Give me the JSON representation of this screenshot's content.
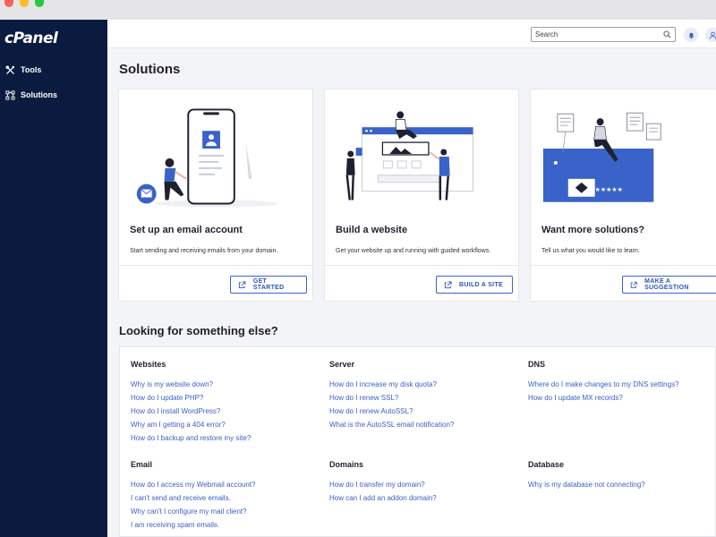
{
  "brand": {
    "logo": "cPanel"
  },
  "sidebar": {
    "items": [
      {
        "label": "Tools"
      },
      {
        "label": "Solutions"
      }
    ]
  },
  "topbar": {
    "search_placeholder": "Search"
  },
  "page": {
    "title": "Solutions"
  },
  "cards": [
    {
      "title": "Set up an email account",
      "description": "Start sending and receiving emails from your domain.",
      "button": "GET STARTED"
    },
    {
      "title": "Build a website",
      "description": "Get your website up and running with guided workflows.",
      "button": "BUILD A SITE"
    },
    {
      "title": "Want more solutions?",
      "description": "Tell us what you would like to learn.",
      "button": "MAKE A SUGGESTION"
    }
  ],
  "help": {
    "title": "Looking for something else?",
    "groups": [
      {
        "title": "Websites",
        "links": [
          "Why is my website down?",
          "How do I update PHP?",
          "How do I install WordPress?",
          "Why am I getting a 404 error?",
          "How do I backup and restore my site?"
        ]
      },
      {
        "title": "Server",
        "links": [
          "How do I increase my disk quota?",
          "How do I renew SSL?",
          "How do I renew AutoSSL?",
          "What is the AutoSSL email notification?"
        ]
      },
      {
        "title": "DNS",
        "links": [
          "Where do I make changes to my DNS settings?",
          "How do I update MX records?"
        ]
      },
      {
        "title": "Email",
        "links": [
          "How do I access my Webmail account?",
          "I can't send and receive emails.",
          "Why can't I configure my mail client?",
          "I am receiving spam emails."
        ]
      },
      {
        "title": "Domains",
        "links": [
          "How do I transfer my domain?",
          "How can I add an addon domain?"
        ]
      },
      {
        "title": "Database",
        "links": [
          "Why is my database not connecting?"
        ]
      }
    ]
  },
  "colors": {
    "sidebar_bg": "#0b1b3f",
    "accent": "#3a63c9",
    "link": "#3d5fc4",
    "dot_close": "#ff5f57",
    "dot_minimize": "#febc2e",
    "dot_zoom": "#28c840"
  },
  "icons": {
    "tools": "tools-icon",
    "solutions": "solutions-icon",
    "search": "search-icon",
    "bell": "bell-icon",
    "user": "user-icon",
    "external_link": "external-link-icon"
  }
}
